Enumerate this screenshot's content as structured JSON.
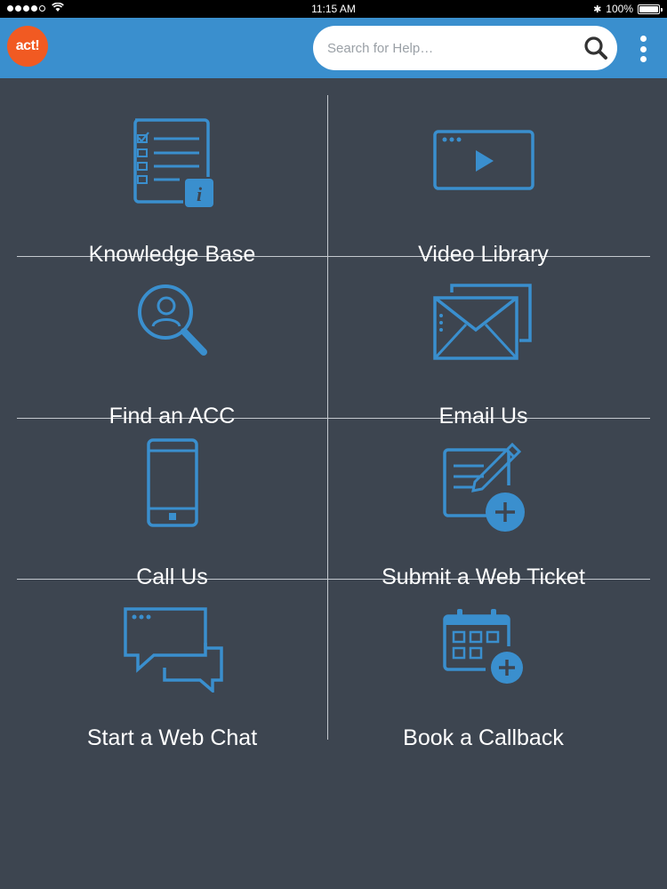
{
  "status_bar": {
    "time": "11:15 AM",
    "battery": "100%",
    "battery_level": 1.0,
    "signal_bars": 4,
    "signal_total": 5
  },
  "header": {
    "logo_text": "act!",
    "search_placeholder": "Search for Help…",
    "search_value": "",
    "search_icon": "search-icon",
    "menu_icon": "more-vertical-icon"
  },
  "colors": {
    "header": "#3a8fce",
    "background": "#3d4550",
    "icon": "#3a8fce",
    "logo": "#f15a22"
  },
  "tiles": [
    {
      "label": "Knowledge Base",
      "icon": "knowledge-base-icon"
    },
    {
      "label": "Video Library",
      "icon": "video-library-icon"
    },
    {
      "label": "Find an ACC",
      "icon": "find-acc-icon"
    },
    {
      "label": "Email Us",
      "icon": "email-icon"
    },
    {
      "label": "Call Us",
      "icon": "phone-icon"
    },
    {
      "label": "Submit a Web Ticket",
      "icon": "web-ticket-icon"
    },
    {
      "label": "Start a Web Chat",
      "icon": "web-chat-icon"
    },
    {
      "label": "Book a Callback",
      "icon": "calendar-callback-icon"
    }
  ]
}
